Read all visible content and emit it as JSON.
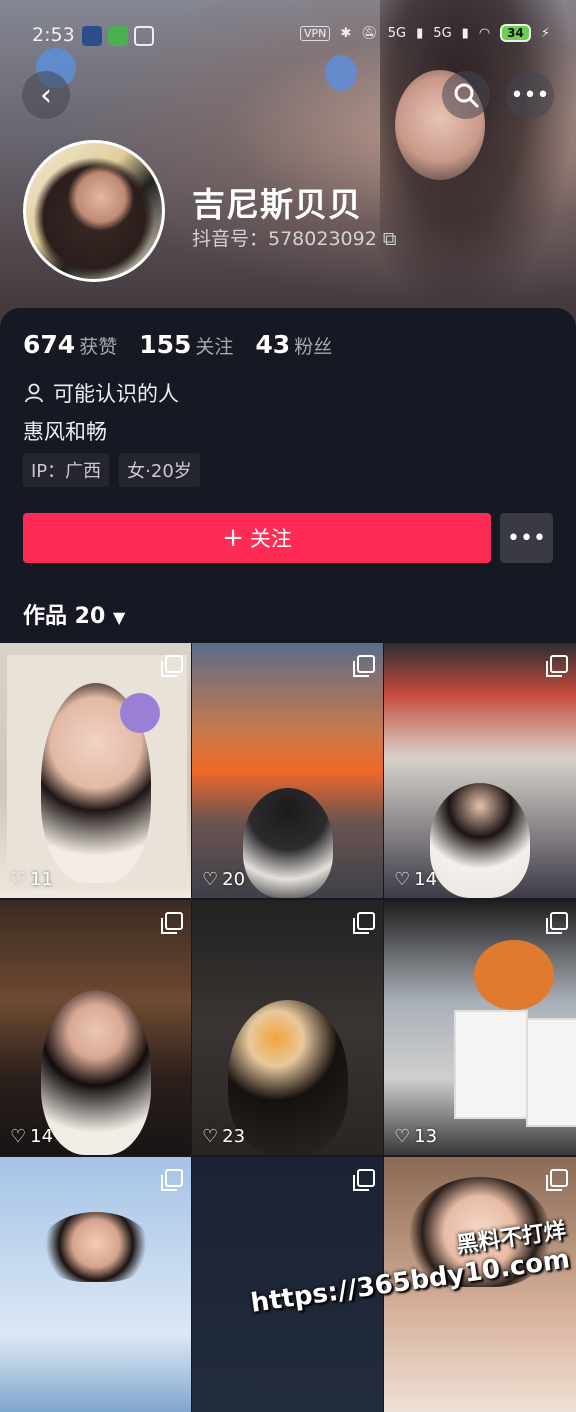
{
  "status_bar": {
    "time": "2:53",
    "vpn": "VPN",
    "net1": "5G",
    "net2": "5G",
    "battery": "34",
    "icons": [
      "cat-app-icon",
      "battery-saver-icon",
      "sync-icon",
      "bluetooth-icon",
      "mute-icon",
      "wifi-icon"
    ]
  },
  "profile": {
    "nickname": "吉尼斯贝贝",
    "douyin_id": "抖音号：578023092"
  },
  "stats": [
    {
      "value": "674",
      "label": "获赞"
    },
    {
      "value": "155",
      "label": "关注"
    },
    {
      "value": "43",
      "label": "粉丝"
    }
  ],
  "known_people": "可能认识的人",
  "bio": "惠风和畅",
  "tags": [
    "IP：广西",
    "女·20岁"
  ],
  "follow_label": "关注",
  "works_label": "作品 20",
  "posts": [
    {
      "likes": "11"
    },
    {
      "likes": "20"
    },
    {
      "likes": "14"
    },
    {
      "likes": "14"
    },
    {
      "likes": "23"
    },
    {
      "likes": "13"
    },
    {
      "likes": ""
    },
    {
      "likes": ""
    },
    {
      "likes": ""
    }
  ],
  "watermark": {
    "line1": "黑料不打烊",
    "line2": "https://365bdy10.com"
  },
  "colors": {
    "follow": "#fe2c55",
    "background": "#161823"
  }
}
